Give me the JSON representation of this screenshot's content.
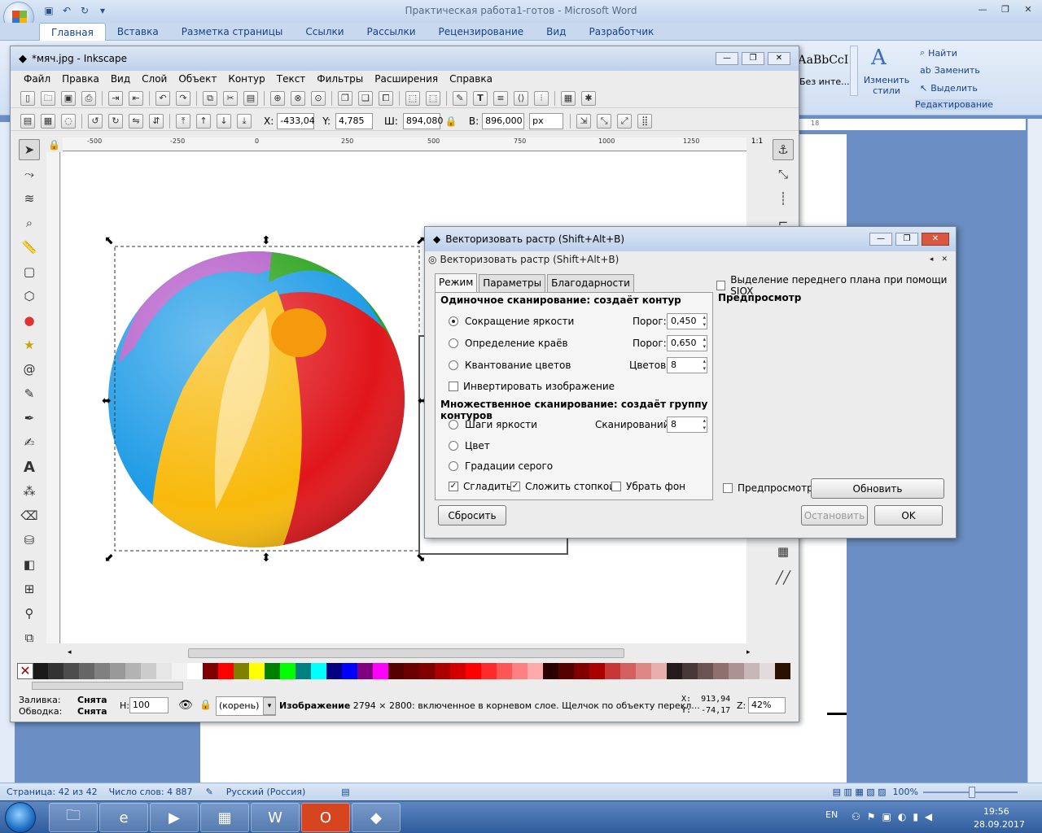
{
  "word": {
    "title": "Практическая работа1-готов - Microsoft Word",
    "tabs": [
      "Главная",
      "Вставка",
      "Разметка страницы",
      "Ссылки",
      "Рассылки",
      "Рецензирование",
      "Вид",
      "Разработчик"
    ],
    "styles": {
      "sample": "АаВbCcI",
      "name": "Без инте..."
    },
    "change_styles": "Изменить стили",
    "edit_group": {
      "find": "Найти",
      "replace": "Заменить",
      "select": "Выделить",
      "label": "Редактирование"
    },
    "ruler_mark": "18",
    "status": {
      "page": "Страница: 42 из 42",
      "words": "Число слов: 4 887",
      "lang": "Русский (Россия)",
      "zoom": "100%"
    }
  },
  "taskbar": {
    "lang": "EN",
    "time": "19:56",
    "date": "28.09.2017"
  },
  "inkscape": {
    "title": "*мяч.jpg - Inkscape",
    "menu": [
      "Файл",
      "Правка",
      "Вид",
      "Слой",
      "Объект",
      "Контур",
      "Текст",
      "Фильтры",
      "Расширения",
      "Справка"
    ],
    "toolbar": {
      "x_label": "X:",
      "x_value": "-433,04",
      "y_label": "Y:",
      "y_value": "4,785",
      "w_label": "Ш:",
      "w_value": "894,080",
      "h_label": "В:",
      "h_value": "896,000",
      "unit": "px"
    },
    "ruler_ticks": [
      "-500",
      "-250",
      "0",
      "250",
      "500",
      "750",
      "1000",
      "1250"
    ],
    "status": {
      "fill_label": "Заливка:",
      "fill_value": "Снята",
      "stroke_label": "Обводка:",
      "stroke_value": "Снята",
      "h_label": "Н:",
      "h_value": "100",
      "layer": "(корень)",
      "message_bold": "Изображение",
      "message": " 2794 × 2800: включенное в корневом слое. Щелчок по объекту перекл...",
      "coord_x": "X:  913,94",
      "coord_y": "Y:  -74,17",
      "zoom_label": "Z:",
      "zoom": "42%"
    }
  },
  "dialog": {
    "title": "Векторизовать растр (Shift+Alt+B)",
    "subtitle": "Векторизовать растр (Shift+Alt+B)",
    "tabs": [
      "Режим",
      "Параметры",
      "Благодарности"
    ],
    "single_header": "Одиночное сканирование: создаёт контур",
    "opt_brightness": "Сокращение яркости",
    "opt_edges": "Определение краёв",
    "opt_colors": "Квантование цветов",
    "threshold_label": "Порог:",
    "threshold1": "0,450",
    "threshold2": "0,650",
    "colors_label": "Цветов:",
    "colors_value": "8",
    "invert": "Инвертировать изображение",
    "multi_header": "Множественное сканирование: создаёт группу контуров",
    "multi_steps": "Шаги яркости",
    "scans_label": "Сканирований:",
    "scans_value": "8",
    "multi_color": "Цвет",
    "multi_gray": "Градации серого",
    "smooth": "Сгладить",
    "stack": "Сложить стопкой",
    "remove_bg": "Убрать фон",
    "siox": "Выделение переднего плана при помощи SIOX",
    "preview_header": "Предпросмотр",
    "preview_check": "Предпросмотр",
    "btn_update": "Обновить",
    "btn_reset": "Сбросить",
    "btn_stop": "Остановить",
    "btn_ok": "OK"
  },
  "palette": [
    "#000000",
    "#1a1a1a",
    "#333333",
    "#4d4d4d",
    "#666666",
    "#808080",
    "#999999",
    "#b3b3b3",
    "#cccccc",
    "#e6e6e6",
    "#f2f2f2",
    "#ffffff",
    "#800000",
    "#ff0000",
    "#808000",
    "#ffff00",
    "#008000",
    "#00ff00",
    "#008080",
    "#00ffff",
    "#000080",
    "#0000ff",
    "#800080",
    "#ff00ff",
    "#550000",
    "#6b0000",
    "#800000",
    "#aa0000",
    "#d40000",
    "#ff0000",
    "#ff2a2a",
    "#ff5555",
    "#ff8080",
    "#ffaaaa",
    "#2b0000",
    "#550000",
    "#800000",
    "#aa0000",
    "#c83737",
    "#d35f5f",
    "#de8787",
    "#e9afaf",
    "#241c1c",
    "#483737",
    "#6c5353",
    "#916f6f",
    "#ac9393",
    "#c8b7b7",
    "#e3dbdb",
    "#2b1100"
  ]
}
